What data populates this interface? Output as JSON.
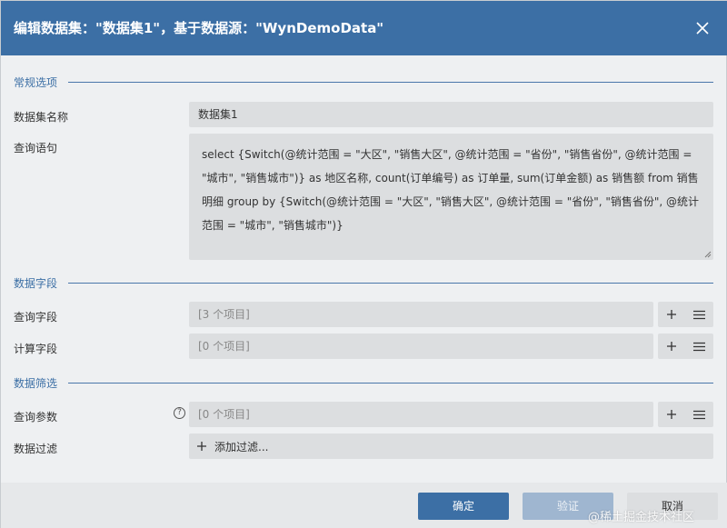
{
  "dialog": {
    "title": "编辑数据集：\"数据集1\"，基于数据源：\"WynDemoData\"",
    "close_icon": "close-icon"
  },
  "general": {
    "section_title": "常规选项",
    "name_label": "数据集名称",
    "name_value": "数据集1",
    "query_label": "查询语句",
    "query_text": "select {Switch(@统计范围 = \"大区\", \"销售大区\", @统计范围 = \"省份\", \"销售省份\", @统计范围 = \"城市\", \"销售城市\")}  as 地区名称, count(订单编号) as 订单量, sum(订单金额) as 销售额 from 销售明细 group by {Switch(@统计范围 = \"大区\", \"销售大区\", @统计范围 = \"省份\", \"销售省份\", @统计范围 = \"城市\", \"销售城市\")}"
  },
  "fields": {
    "section_title": "数据字段",
    "query_fields_label": "查询字段",
    "query_fields_value": "[3 个项目]",
    "calc_fields_label": "计算字段",
    "calc_fields_value": "[0 个项目]"
  },
  "filter": {
    "section_title": "数据筛选",
    "params_label": "查询参数",
    "params_value": "[0 个项目]",
    "help_glyph": "?",
    "filter_label": "数据过滤",
    "add_filter_label": "添加过滤..."
  },
  "footer": {
    "ok_label": "确定",
    "verify_label": "验证",
    "cancel_label": "取消"
  },
  "watermark": "@稀土掘金技术社区",
  "colors": {
    "titlebar": "#3c6fa5",
    "accent": "#3c6fa5",
    "field_bg": "#dcdee0",
    "body_bg": "#eef0f2"
  }
}
